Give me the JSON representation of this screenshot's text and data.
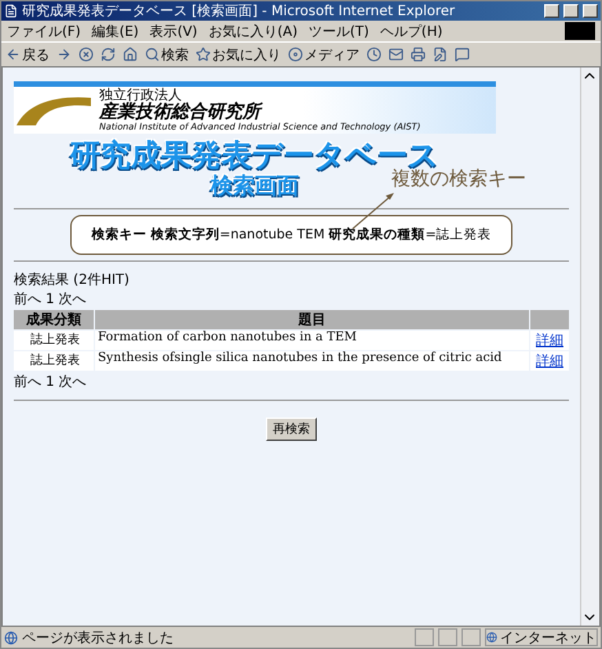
{
  "window": {
    "title": "研究成果発表データベース [検索画面] - Microsoft Internet Explorer"
  },
  "menu": [
    "ファイル(F)",
    "編集(E)",
    "表示(V)",
    "お気に入り(A)",
    "ツール(T)",
    "ヘルプ(H)"
  ],
  "toolbar": [
    {
      "kind": "back",
      "label": "戻る"
    },
    {
      "kind": "forward"
    },
    {
      "kind": "stop"
    },
    {
      "kind": "refresh"
    },
    {
      "kind": "home"
    },
    {
      "kind": "search",
      "label": "検索"
    },
    {
      "kind": "favorites",
      "label": "お気に入り"
    },
    {
      "kind": "media",
      "label": "メディア"
    },
    {
      "kind": "history"
    },
    {
      "kind": "mail"
    },
    {
      "kind": "print"
    },
    {
      "kind": "edit"
    },
    {
      "kind": "discuss"
    }
  ],
  "banner": {
    "org_type": "独立行政法人",
    "org_name": "産業技術総合研究所",
    "org_english": "National Institute of Advanced Industrial Science and Technology (AIST)"
  },
  "title_lines": [
    "研究成果発表データベース",
    "検索画面"
  ],
  "annotation": "複数の検索キー",
  "search_keys": "**検索キー** **検索文字列**=nanotube TEM **研究成果の種類**=誌上発表",
  "results": {
    "summary": "検索結果 (2件HIT)",
    "pager_top": "前へ 1 次へ",
    "columns": [
      "成果分類",
      "題目"
    ],
    "rows": [
      {
        "category": "誌上発表",
        "title": "Formation of carbon nanotubes in a TEM",
        "link": "詳細"
      },
      {
        "category": "誌上発表",
        "title": "Synthesis ofsingle silica nanotubes in the presence of citric acid",
        "link": "詳細"
      }
    ],
    "pager_bottom": "前へ 1 次へ"
  },
  "button": "再検索",
  "status_bar": {
    "message": "ページが表示されました",
    "zone": "インターネット"
  }
}
